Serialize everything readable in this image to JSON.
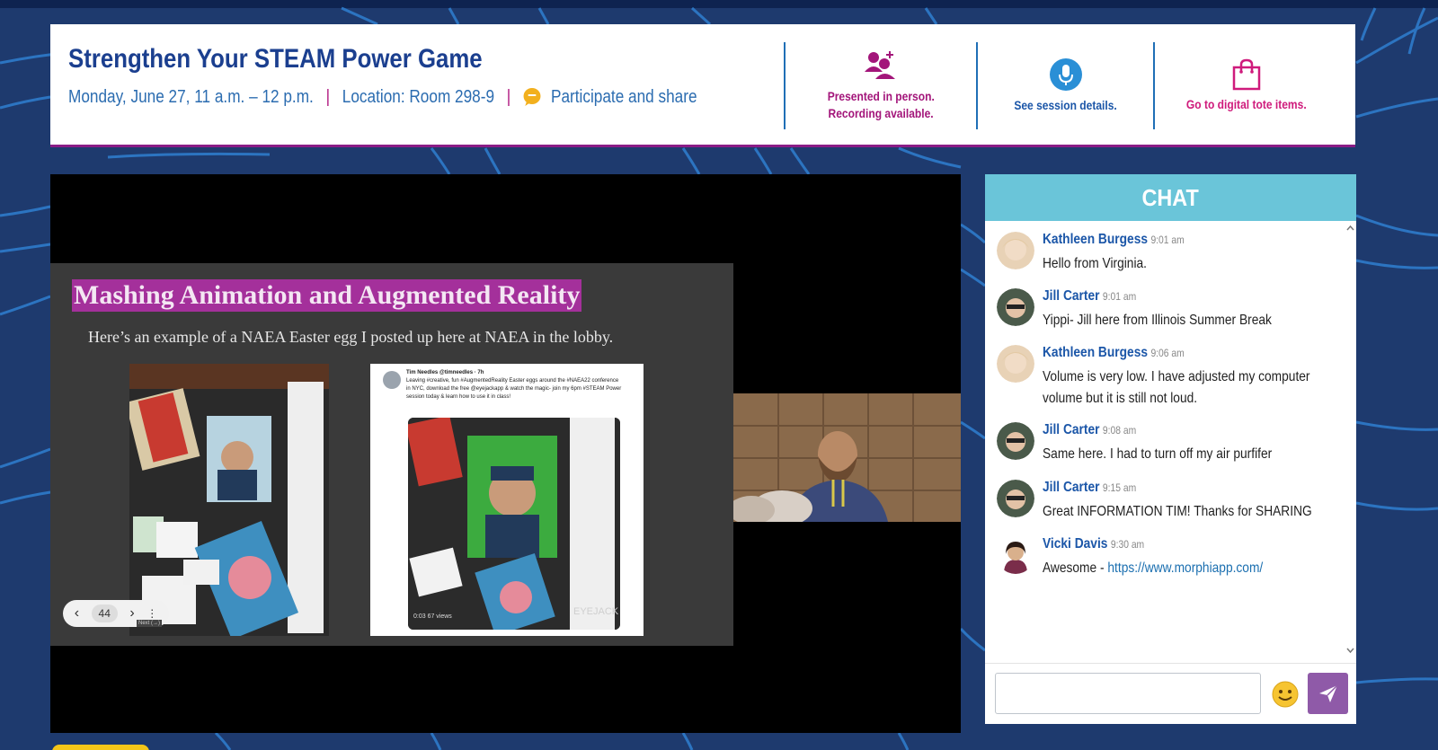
{
  "session": {
    "title": "Strengthen Your STEAM Power Game",
    "datetime": "Monday, June 27, 11 a.m. – 12 p.m.",
    "separator": "|",
    "location": "Location: Room 298-9",
    "participate": "Participate and share",
    "actions": [
      {
        "icon": "people-icon",
        "line1": "Presented in person.",
        "line2": "Recording available."
      },
      {
        "icon": "microphone-icon",
        "line1": "See session details."
      },
      {
        "icon": "shopping-bag-icon",
        "line1": "Go to digital tote items."
      }
    ]
  },
  "slide": {
    "title": "Mashing Animation and Augmented Reality",
    "subtitle": "Here’s an example of a NAEA Easter egg I posted up here at NAEA in the lobby.",
    "tweet_author": "Tim Needles @timneedles · 7h",
    "tweet_text": "Leaving #creative, fun #AugmentedReality Easter eggs around the #NAEA22 conference in NYC, download the free @eyejackapp & watch the magic- join my 6pm #STEAM Power session today & learn how to use it in class!",
    "tweet_watermark": "EYEJACK",
    "tweet_views": "0:03  67 views",
    "nav": {
      "prev": "‹",
      "page": "44",
      "next": "›",
      "more": "⋮",
      "tooltip": "Next (→)"
    }
  },
  "chat": {
    "header": "CHAT",
    "messages": [
      {
        "name": "Kathleen Burgess",
        "time": "9:01 am",
        "text": "Hello from Virginia."
      },
      {
        "name": "Jill Carter",
        "time": "9:01 am",
        "text": "Yippi- Jill here from Illinois Summer Break"
      },
      {
        "name": "Kathleen Burgess",
        "time": "9:06 am",
        "text": "Volume is very low. I have adjusted my computer volume but it is still not loud."
      },
      {
        "name": "Jill Carter",
        "time": "9:08 am",
        "text": "Same here. I had to turn off my air purfifer"
      },
      {
        "name": "Jill Carter",
        "time": "9:15 am",
        "text": "Great INFORMATION TIM! Thanks for SHARING"
      },
      {
        "name": "Vicki Davis",
        "time": "9:30 am",
        "text": "Awesome - ",
        "link": "https://www.morphiapp.com/"
      }
    ],
    "input_placeholder": "",
    "emoji": "🙂",
    "send_icon": "send-icon"
  },
  "colors": {
    "background": "#1e3a6e",
    "title": "#1b3f8f",
    "accent_magenta": "#a3157a",
    "chat_header": "#6ac5d9",
    "send_button": "#8f5aa8"
  }
}
